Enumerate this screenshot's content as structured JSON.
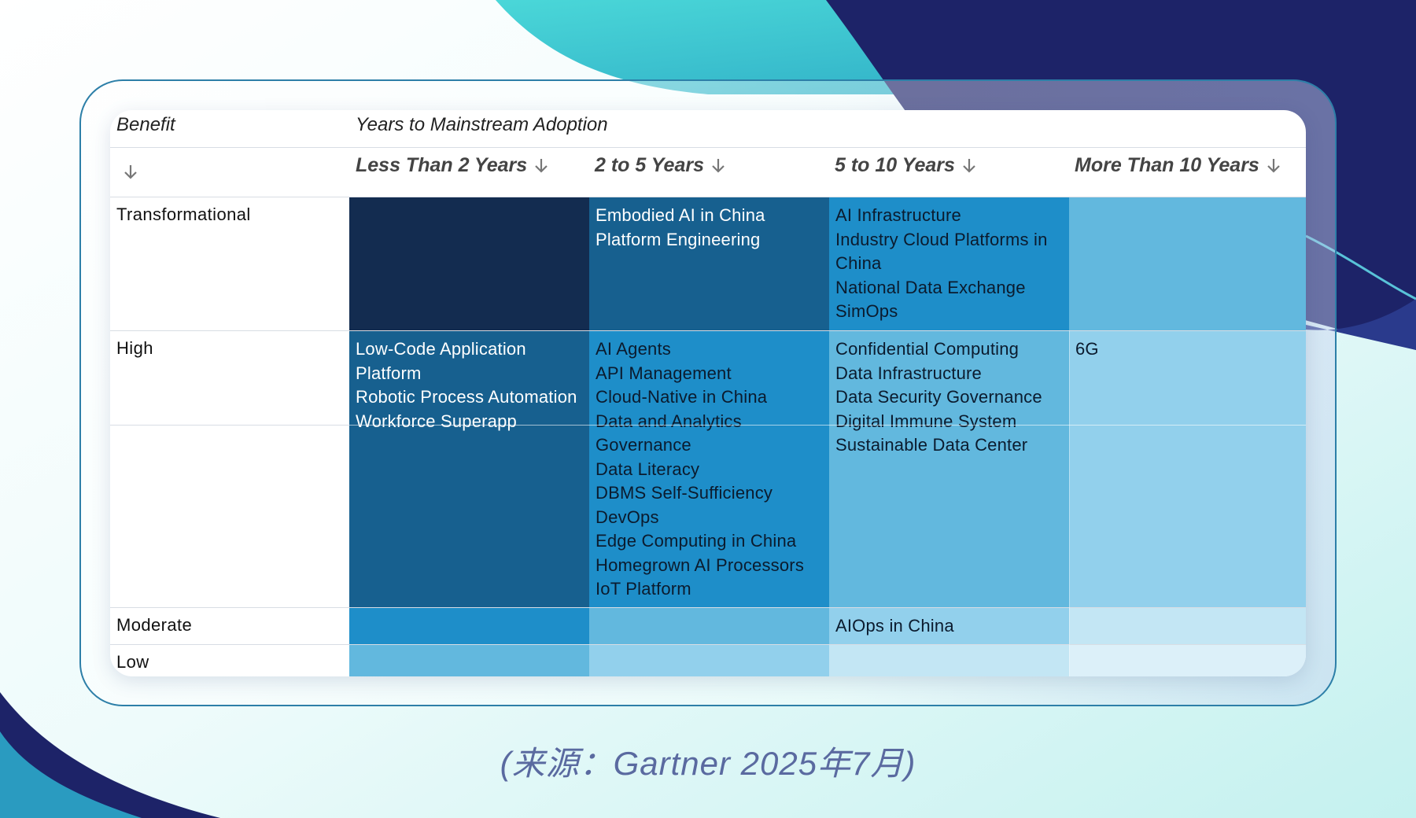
{
  "table": {
    "benefit_header": "Benefit",
    "years_header": "Years to Mainstream Adoption",
    "columns": [
      "Less Than 2 Years",
      "2 to 5 Years",
      "5 to 10 Years",
      "More Than 10 Years"
    ],
    "rows": [
      {
        "label": "Transformational",
        "cells": [
          [],
          [
            "Embodied AI in China",
            "Platform Engineering"
          ],
          [
            "AI Infrastructure",
            "Industry Cloud Platforms in China",
            "National Data Exchange",
            "SimOps"
          ],
          []
        ]
      },
      {
        "label": "High",
        "cells": [
          [
            "Low-Code Application Platform",
            "Robotic Process Automation",
            "Workforce Superapp"
          ],
          [
            "AI Agents",
            "API Management",
            "Cloud-Native in China",
            "Data and Analytics Governance",
            "Data Literacy",
            "DBMS Self-Sufficiency",
            "DevOps",
            "Edge Computing in China",
            "Homegrown AI Processors",
            "IoT Platform"
          ],
          [
            "Confidential Computing",
            "Data Infrastructure",
            "Data Security Governance",
            "Digital Immune System",
            "Sustainable Data Center"
          ],
          [
            "6G"
          ]
        ]
      },
      {
        "label": "Moderate",
        "cells": [
          [],
          [],
          [
            "AIOps in China"
          ],
          []
        ]
      },
      {
        "label": "Low",
        "cells": [
          [],
          [],
          [],
          []
        ]
      }
    ]
  },
  "source": "(来源：Gartner 2025年7月)",
  "icons": {
    "sort": "arrow-down-icon"
  },
  "colors": {
    "darkest": "#132c50",
    "dark": "#17608f",
    "medium": "#1e8ec9",
    "medium_light": "#62b8de",
    "light": "#92d0ec",
    "lighter": "#c3e6f4",
    "lightest": "#dcf0f9",
    "accent_teal": "#3fd0d4",
    "accent_navy": "#1d2368"
  }
}
